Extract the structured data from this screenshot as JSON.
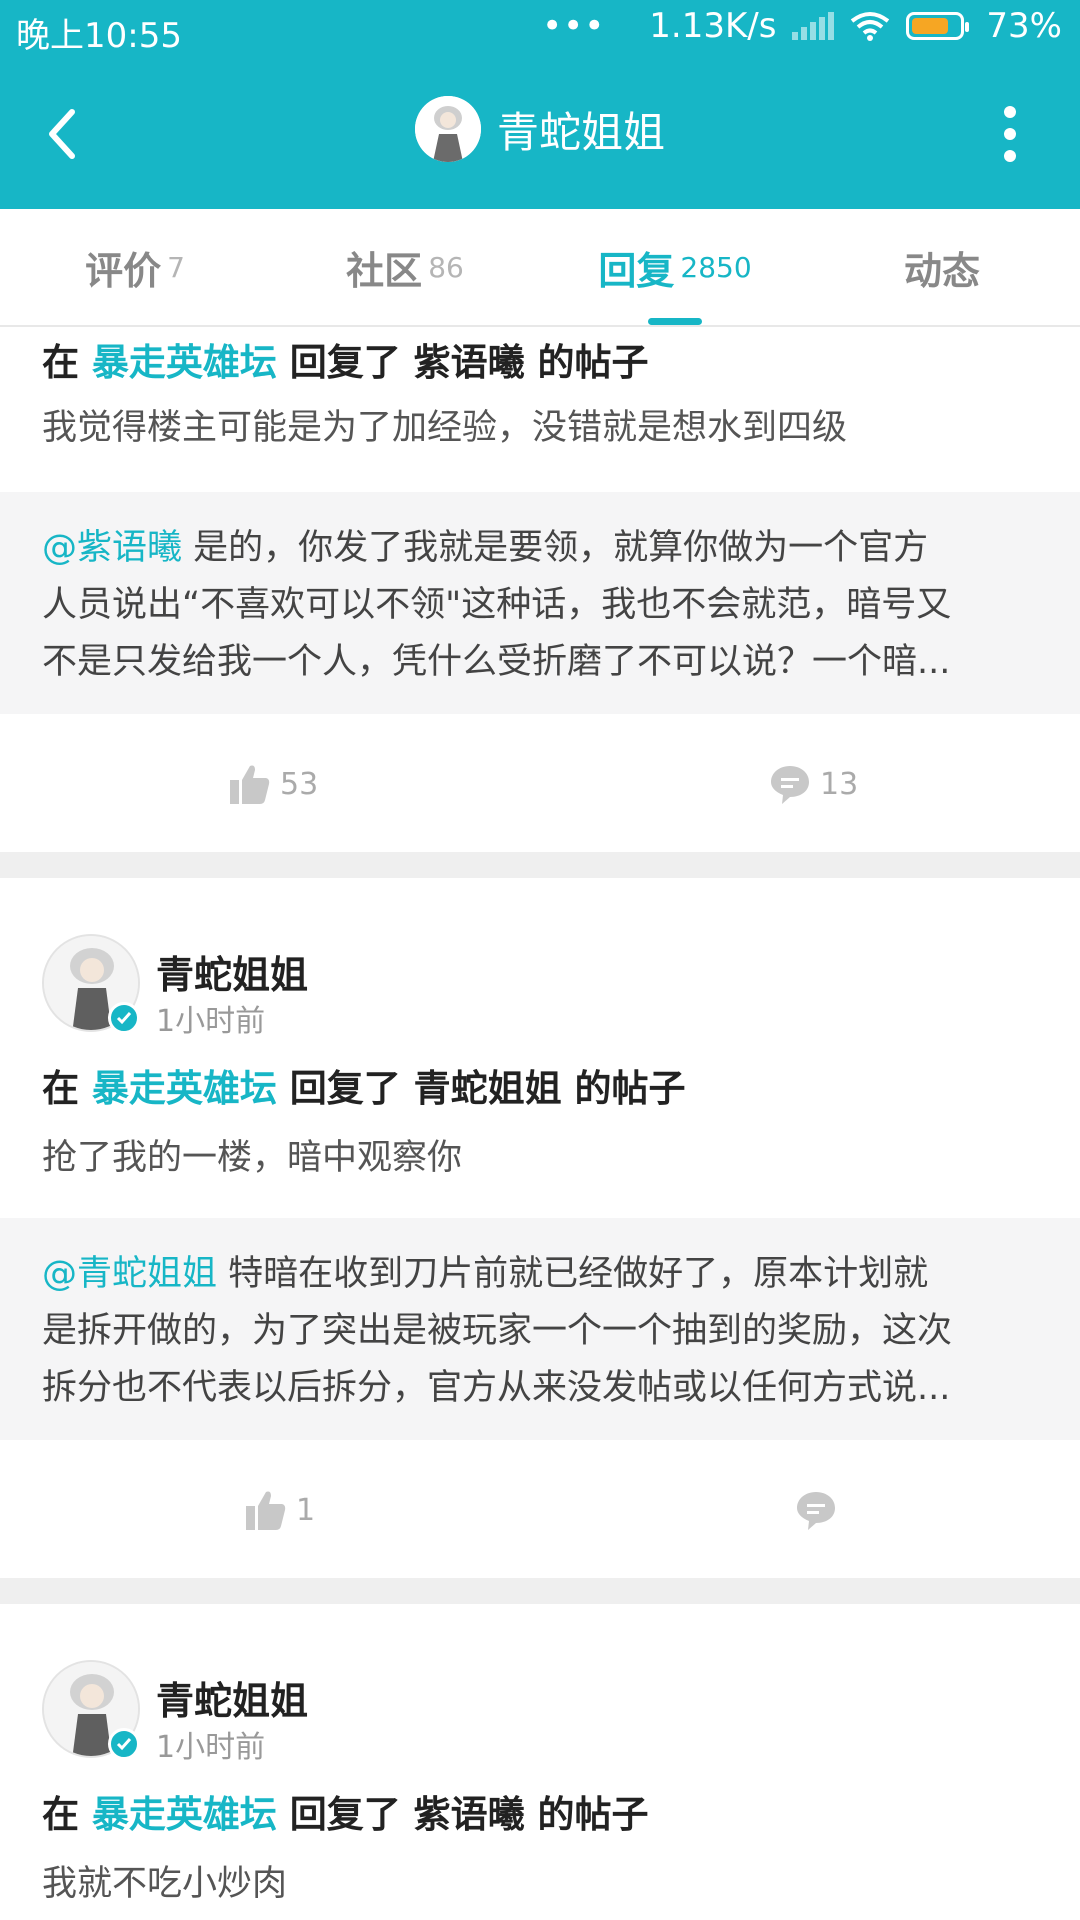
{
  "status": {
    "time": "晚上10:55",
    "dots": "•••",
    "speed": "1.13K/s",
    "battery": "73%"
  },
  "header": {
    "title": "青蛇姐姐"
  },
  "tabs": [
    {
      "label": "评价",
      "count": "7"
    },
    {
      "label": "社区",
      "count": "86"
    },
    {
      "label": "回复",
      "count": "2850"
    },
    {
      "label": "动态",
      "count": ""
    }
  ],
  "posts": [
    {
      "reply_prefix": "在 ",
      "forum": "暴走英雄坛",
      "reply_mid": " 回复了 ",
      "target": "紫语曦",
      "reply_suffix": " 的帖子",
      "text": "我觉得楼主可能是为了加经验，没错就是想水到四级",
      "mention": "@紫语曦",
      "quote_lines": [
        " 是的，你发了我就是要领，就算你做为一个官方",
        "人员说出“不喜欢可以不领\"这种话，我也不会就范，暗号又",
        "不是只发给我一个人，凭什么受折磨了不可以说？一个暗..."
      ],
      "likes": "53",
      "comments": "13"
    },
    {
      "user": "青蛇姐姐",
      "time": "1小时前",
      "reply_prefix": "在 ",
      "forum": "暴走英雄坛",
      "reply_mid": " 回复了 ",
      "target": "青蛇姐姐",
      "reply_suffix": " 的帖子",
      "text": "抢了我的一楼，暗中观察你",
      "mention": "@青蛇姐姐",
      "quote_lines": [
        " 特暗在收到刀片前就已经做好了，原本计划就",
        "是拆开做的，为了突出是被玩家一个一个抽到的奖励，这次",
        "拆分也不代表以后拆分，官方从来没发帖或以任何方式说..."
      ],
      "likes": "1",
      "comments": ""
    },
    {
      "user": "青蛇姐姐",
      "time": "1小时前",
      "reply_prefix": "在 ",
      "forum": "暴走英雄坛",
      "reply_mid": " 回复了 ",
      "target": "紫语曦",
      "reply_suffix": " 的帖子",
      "text": "我就不吃小炒肉"
    }
  ],
  "colors": {
    "accent": "#17b6c6",
    "battery": "#f6a623",
    "divider": "#efefef",
    "quote_bg": "#f5f5f6"
  },
  "icons": {
    "back": "chevron-left-icon",
    "more": "more-vertical-icon",
    "like": "thumbs-up-icon",
    "comment": "comment-bubble-icon",
    "verified": "verified-check-icon"
  }
}
